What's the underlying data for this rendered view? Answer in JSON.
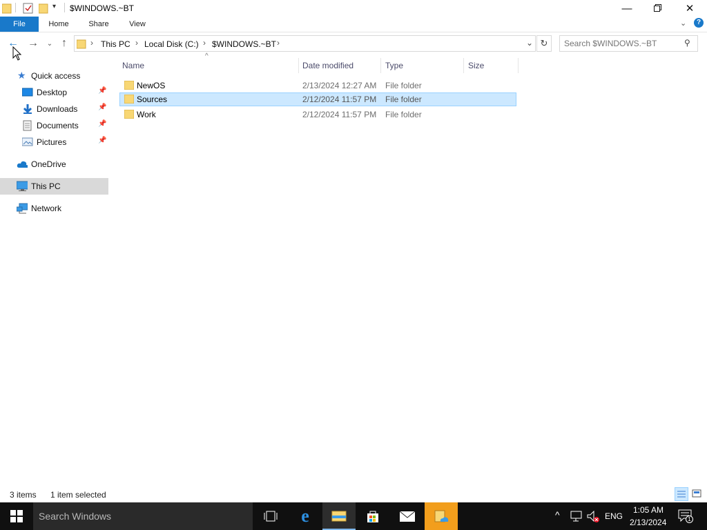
{
  "window": {
    "title": "$WINDOWS.~BT",
    "controls": [
      "minimize",
      "restore",
      "close"
    ]
  },
  "ribbon": {
    "tabs": [
      {
        "label": "File",
        "active": true
      },
      {
        "label": "Home"
      },
      {
        "label": "Share"
      },
      {
        "label": "View"
      }
    ]
  },
  "address": {
    "breadcrumbs": [
      "This PC",
      "Local Disk (C:)",
      "$WINDOWS.~BT"
    ]
  },
  "search": {
    "placeholder": "Search $WINDOWS.~BT"
  },
  "nav": {
    "items": [
      {
        "label": "Quick access",
        "icon": "star-icon"
      },
      {
        "label": "Desktop",
        "icon": "desktop-icon",
        "pinned": true
      },
      {
        "label": "Downloads",
        "icon": "download-arrow-icon",
        "pinned": true
      },
      {
        "label": "Documents",
        "icon": "documents-icon",
        "pinned": true
      },
      {
        "label": "Pictures",
        "icon": "pictures-icon",
        "pinned": true
      },
      {
        "label": "OneDrive",
        "icon": "cloud-icon"
      },
      {
        "label": "This PC",
        "icon": "computer-icon",
        "selected": true
      },
      {
        "label": "Network",
        "icon": "network-icon"
      }
    ]
  },
  "list": {
    "columns": [
      "Name",
      "Date modified",
      "Type",
      "Size"
    ],
    "rows": [
      {
        "name": "NewOS",
        "date": "2/13/2024 12:27 AM",
        "type": "File folder",
        "size": ""
      },
      {
        "name": "Sources",
        "date": "2/12/2024 11:57 PM",
        "type": "File folder",
        "size": "",
        "selected": true
      },
      {
        "name": "Work",
        "date": "2/12/2024 11:57 PM",
        "type": "File folder",
        "size": ""
      }
    ]
  },
  "status": {
    "count": "3 items",
    "selection": "1 item selected"
  },
  "taskbar": {
    "search_placeholder": "Search Windows",
    "language": "ENG",
    "time": "1:05 AM",
    "date": "2/13/2024",
    "notification_count": "1"
  },
  "colors": {
    "accent": "#1979ca",
    "selection_bg": "#cce8ff",
    "selection_border": "#99d1ff",
    "folder": "#f8d775",
    "taskbar": "#101010"
  }
}
